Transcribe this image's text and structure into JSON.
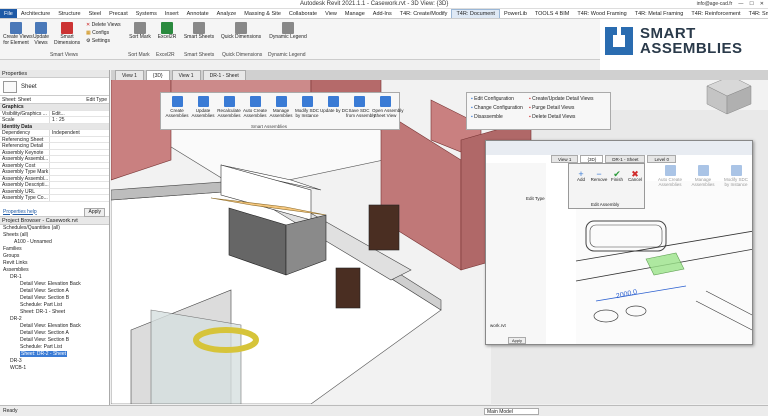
{
  "app": {
    "title": "Autodesk Revit 2021.1.1 - Casework.rvt - 3D View: {3D}",
    "user": "info@age-cad.fr"
  },
  "menu": [
    "File",
    "Architecture",
    "Structure",
    "Steel",
    "Precast",
    "Systems",
    "Insert",
    "Annotate",
    "Analyze",
    "Massing & Site",
    "Collaborate",
    "View",
    "Manage",
    "Add-Ins",
    "T4R: Create/Modify",
    "T4R: Document",
    "PowerLib",
    "TOOLS 4 BIM",
    "T4R: Wood Framing",
    "T4R: Metal Framing",
    "T4R: Reinforcement",
    "T4R: Smart MEP"
  ],
  "ribbon": {
    "create_views": "Create Views\nfor Element",
    "update_views": "Update\nViews",
    "smart_dimensions": "Smart\nDimensions",
    "delete_views": "Delete Views",
    "configs": "Configs",
    "settings": "Settings",
    "sort_mark": "Sort Mark",
    "excel2r": "Excel2R",
    "smart_sheets": "Smart Sheets",
    "quick_dimensions": "Quick Dimensions",
    "dynamic_legend": "Dynamic Legend",
    "panel_smart_views": "Smart Views",
    "panel_sort_mark": "Sort Mark",
    "panel_excel2r": "Excel2R",
    "panel_smart_sheets": "Smart Sheets",
    "panel_quick_dimensions": "Quick Dimensions",
    "panel_dynamic_legend": "Dynamic Legend"
  },
  "logo": {
    "line1": "SMART",
    "line2": "ASSEMBLIES",
    "color": "#2a6cb0"
  },
  "properties": {
    "header": "Properties",
    "type": "Sheet",
    "selector": "Sheet: Sheet",
    "edit_type": "Edit Type",
    "section_graphics": "Graphics",
    "rows_graphics": [
      {
        "k": "Visibility/Graphics ...",
        "v": "Edit..."
      },
      {
        "k": "Scale",
        "v": "1 : 25"
      }
    ],
    "section_identity": "Identity Data",
    "rows_identity": [
      {
        "k": "Dependency",
        "v": "Independent"
      },
      {
        "k": "Referencing Sheet",
        "v": ""
      },
      {
        "k": "Referencing Detail",
        "v": ""
      },
      {
        "k": "Assembly Keynote",
        "v": ""
      },
      {
        "k": "Assembly Assembl...",
        "v": ""
      },
      {
        "k": "Assembly Cost",
        "v": ""
      },
      {
        "k": "Assembly Type Mark",
        "v": ""
      },
      {
        "k": "Assembly Assembl...",
        "v": ""
      },
      {
        "k": "Assembly Descripti...",
        "v": ""
      },
      {
        "k": "Assembly URL",
        "v": ""
      },
      {
        "k": "Assembly Type Co...",
        "v": ""
      }
    ],
    "help": "Properties help",
    "apply": "Apply"
  },
  "browser": {
    "header": "Project Browser - Casework.rvt",
    "items": [
      "Schedules/Quantities (all)",
      "Sheets (all)",
      "A100 - Unnamed",
      "Families",
      "Groups",
      "Revit Links",
      "Assemblies",
      "DR-1",
      "Detail View: Elevation Back",
      "Detail View: Section A",
      "Detail View: Section B",
      "Schedule: Part List",
      "Sheet: DR-1 - Sheet",
      "DR-2",
      "Detail View: Elevation Back",
      "Detail View: Section A",
      "Detail View: Section B",
      "Schedule: Part List",
      "Sheet: DR-2 - Sheet",
      "DR-3",
      "WCB-1"
    ]
  },
  "view_tabs": [
    "View 1",
    "{3D}",
    "View 1",
    "DR-1 - Sheet"
  ],
  "float_toolbar": {
    "items": [
      "Create\nAssemblies",
      "Update\nAssemblies",
      "Recalculate\nAssemblies",
      "Auto Create\nAssemblies",
      "Manage\nAssemblies",
      "Modify SDC\nby Instance",
      "Update by DC",
      "Save SDC\nfrom Assembly",
      "Open Assembly\nSheet View"
    ],
    "panel": "Smart Assemblies",
    "list1": [
      "Edit Configuration",
      "Change Configuration",
      "Disassemble"
    ],
    "list2": [
      "Create/Update Detail Views",
      "Purge Detail Views",
      "Delete Detail Views"
    ]
  },
  "popup": {
    "tabs": [
      "View 1",
      "{3D}",
      "DR-1 - Sheet",
      "Level 0"
    ],
    "edit_type": "Edit Type",
    "apply": "Apply",
    "file": "work.rvt",
    "edit_assembly": {
      "buttons": [
        "Add",
        "Remove",
        "Finish",
        "Cancel"
      ],
      "label": "Edit Assembly"
    },
    "ribbon_items": [
      "Auto Create\nAssemblies",
      "Manage\nAssemblies",
      "Modify SDC\nby Instance"
    ],
    "dimension": "2000.0"
  },
  "status": {
    "left": "Ready",
    "model": "Main Model"
  }
}
